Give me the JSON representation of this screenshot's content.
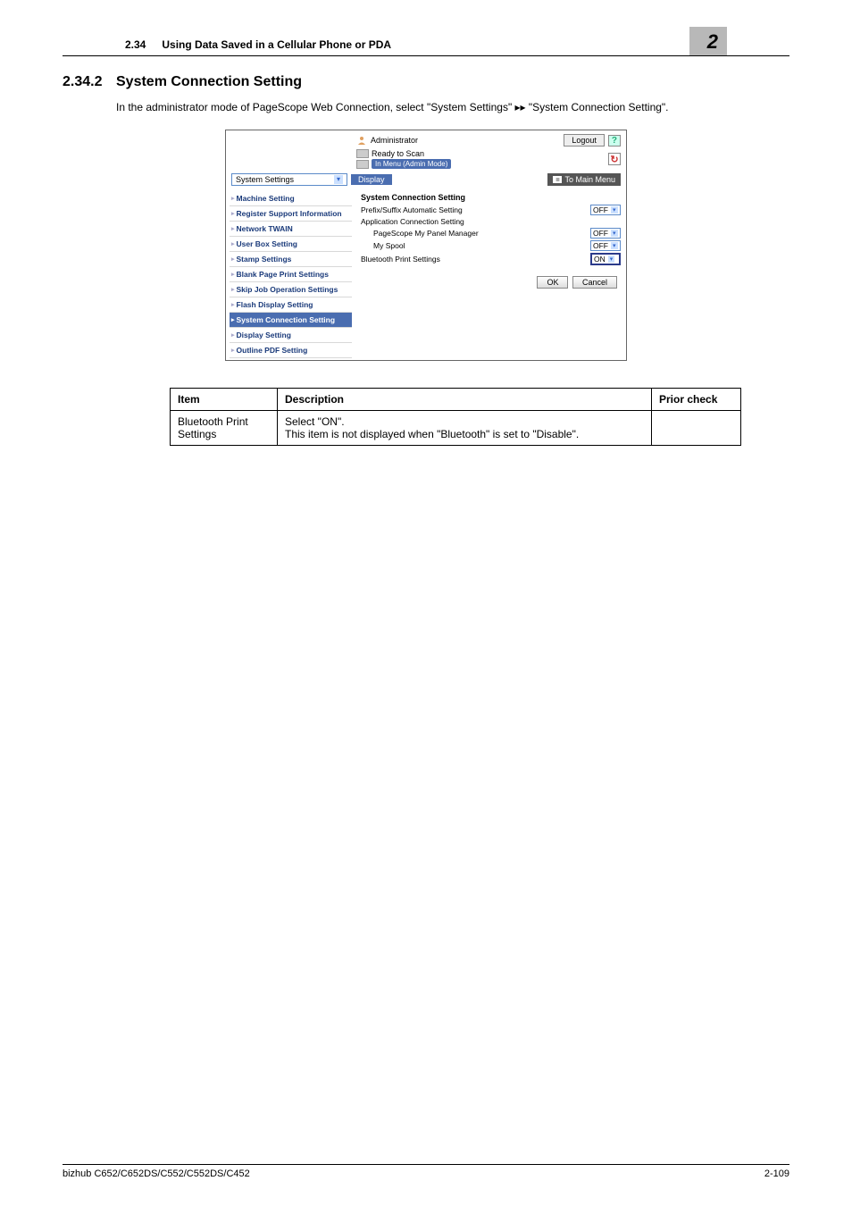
{
  "header": {
    "section_num": "2.34",
    "title": "Using Data Saved in a Cellular Phone or PDA",
    "chapter": "2"
  },
  "section": {
    "num": "2.34.2",
    "title": "System Connection Setting",
    "body": "In the administrator mode of PageScope Web Connection, select \"System Settings\" ▸▸ \"System Connection Setting\"."
  },
  "ui": {
    "admin_label": "Administrator",
    "logout": "Logout",
    "help": "?",
    "status1": "Ready to Scan",
    "status2": "In Menu (Admin Mode)",
    "refresh": "↻",
    "select_value": "System Settings",
    "display_btn": "Display",
    "main_menu_btn": "To Main Menu",
    "sidebar": [
      "Machine Setting",
      "Register Support Information",
      "Network TWAIN",
      "User Box Setting",
      "Stamp Settings",
      "Blank Page Print Settings",
      "Skip Job Operation Settings",
      "Flash Display Setting",
      "System Connection Setting",
      "Display Setting",
      "Outline PDF Setting"
    ],
    "main_title": "System Connection Setting",
    "fields": [
      {
        "label": "Prefix/Suffix Automatic Setting",
        "value": "OFF",
        "indent": false
      },
      {
        "label": "Application Connection Setting",
        "value": "",
        "indent": false
      },
      {
        "label": "PageScope My Panel Manager",
        "value": "OFF",
        "indent": true
      },
      {
        "label": "My Spool",
        "value": "OFF",
        "indent": true
      },
      {
        "label": "Bluetooth Print Settings",
        "value": "ON",
        "indent": false,
        "highlight": true
      }
    ],
    "ok_btn": "OK",
    "cancel_btn": "Cancel"
  },
  "table": {
    "headers": [
      "Item",
      "Description",
      "Prior check"
    ],
    "row": {
      "item": "Bluetooth Print Settings",
      "desc": "Select \"ON\".\nThis item is not displayed when \"Bluetooth\" is set to \"Disable\".",
      "prior": ""
    }
  },
  "footer": {
    "left": "bizhub C652/C652DS/C552/C552DS/C452",
    "right": "2-109"
  }
}
